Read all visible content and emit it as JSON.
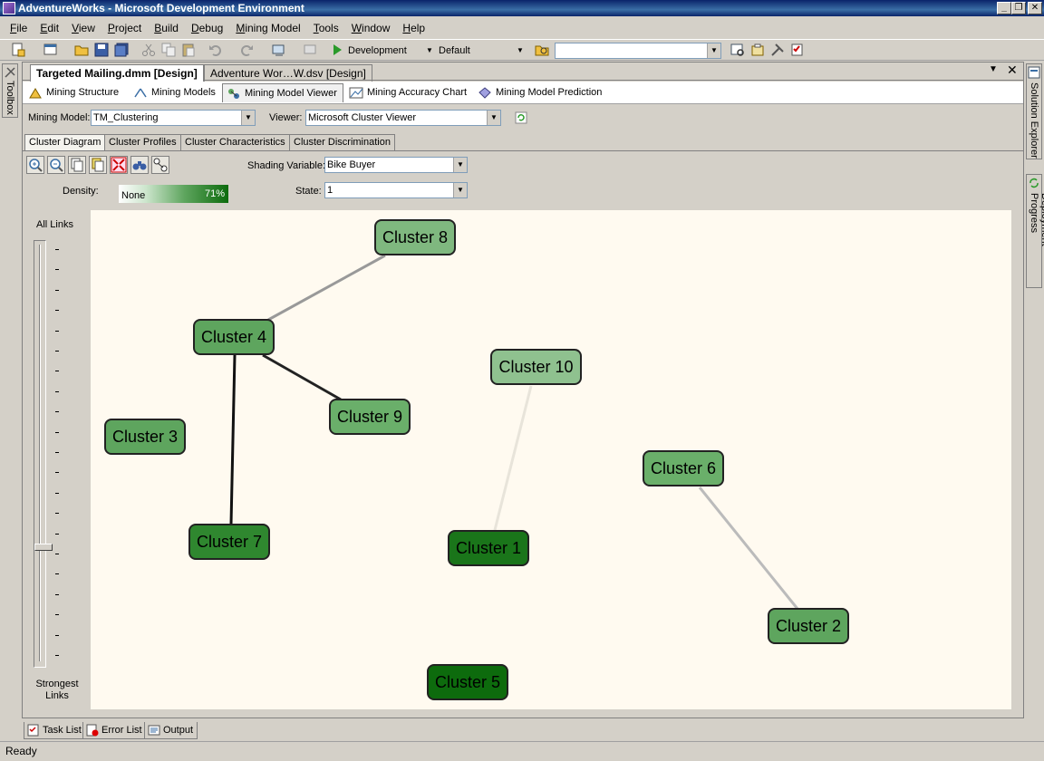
{
  "window": {
    "title": "AdventureWorks - Microsoft Development Environment"
  },
  "menu": [
    "File",
    "Edit",
    "View",
    "Project",
    "Build",
    "Debug",
    "Mining Model",
    "Tools",
    "Window",
    "Help"
  ],
  "menu_underline": [
    "F",
    "E",
    "V",
    "P",
    "B",
    "D",
    "M",
    "T",
    "W",
    "H"
  ],
  "toolbar": {
    "config": "Development",
    "platform": "Default",
    "find": ""
  },
  "side": {
    "left": "Toolbox",
    "right_top": "Solution Explorer",
    "right_bottom": "Deployment Progress"
  },
  "doc_tabs": [
    "Targeted Mailing.dmm [Design]",
    "Adventure Wor…W.dsv [Design]"
  ],
  "designer_tabs": [
    "Mining Structure",
    "Mining Models",
    "Mining Model Viewer",
    "Mining Accuracy Chart",
    "Mining Model Prediction"
  ],
  "model": {
    "label": "Mining Model:",
    "value": "TM_Clustering"
  },
  "viewer": {
    "label": "Viewer:",
    "value": "Microsoft Cluster Viewer"
  },
  "viewer_tabs": [
    "Cluster Diagram",
    "Cluster Profiles",
    "Cluster Characteristics",
    "Cluster Discrimination"
  ],
  "shading": {
    "label": "Shading Variable:",
    "value": "Bike Buyer"
  },
  "state": {
    "label": "State:",
    "value": "1"
  },
  "density": {
    "label": "Density:",
    "min": "None",
    "max": "71%"
  },
  "links": {
    "top": "All Links",
    "bottom": "Strongest Links",
    "level": 0.73
  },
  "clusters": [
    {
      "name": "Cluster 8",
      "color": "#7fb87f"
    },
    {
      "name": "Cluster 4",
      "color": "#5ea55e"
    },
    {
      "name": "Cluster 9",
      "color": "#6aaf6a"
    },
    {
      "name": "Cluster 3",
      "color": "#5ea55e"
    },
    {
      "name": "Cluster 7",
      "color": "#2f872f"
    },
    {
      "name": "Cluster 10",
      "color": "#8fc18f"
    },
    {
      "name": "Cluster 1",
      "color": "#1a751a"
    },
    {
      "name": "Cluster 6",
      "color": "#6aaf6a"
    },
    {
      "name": "Cluster 2",
      "color": "#5ea55e"
    },
    {
      "name": "Cluster 5",
      "color": "#0d6b0d"
    }
  ],
  "bottom_tabs": [
    "Task List",
    "Error List",
    "Output"
  ],
  "status": "Ready"
}
